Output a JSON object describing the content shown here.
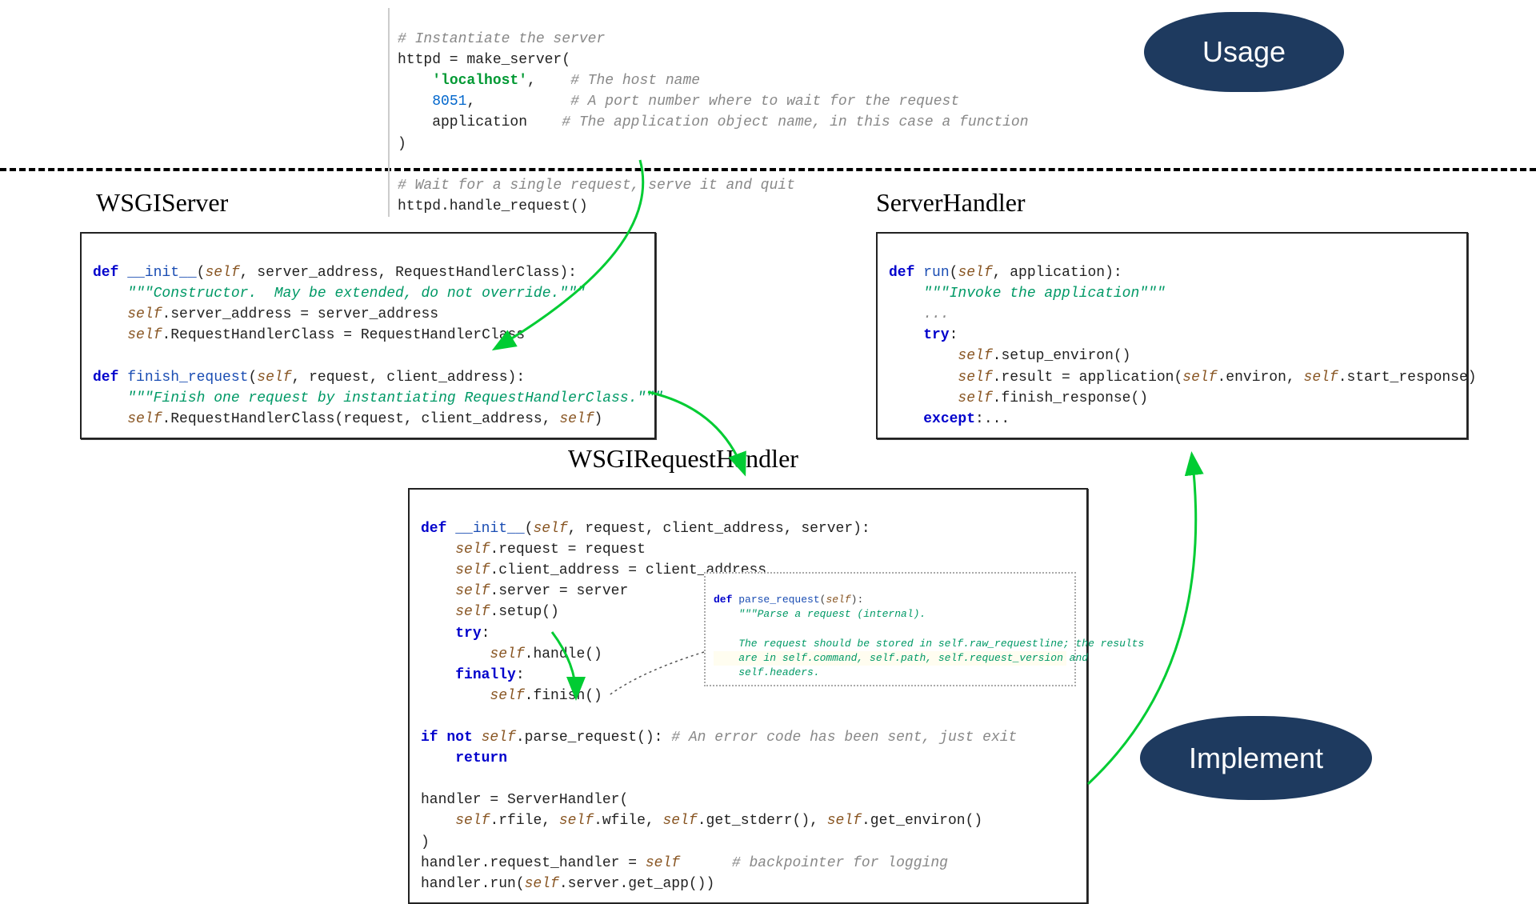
{
  "badges": {
    "usage": "Usage",
    "implement": "Implement"
  },
  "labels": {
    "wsgiserver": "WSGIServer",
    "wsgirequesthandler": "WSGIRequestHandler",
    "serverhandler": "ServerHandler"
  },
  "code": {
    "top_c1": "# Instantiate the server",
    "top_l2a": "httpd = make_server(",
    "top_l3a": "    ",
    "top_l3b": "'localhost'",
    "top_l3c": ",    ",
    "top_l3d": "# The host name",
    "top_l4a": "    ",
    "top_l4b": "8051",
    "top_l4c": ",           ",
    "top_l4d": "# A port number where to wait for the request",
    "top_l5a": "    application    ",
    "top_l5b": "# The application object name, in this case a function",
    "top_l6": ")",
    "top_blank": "",
    "top_c2": "# Wait for a single request, serve it and quit",
    "top_l8": "httpd.handle_request()",
    "ws_def1a": "def ",
    "ws_def1b": "__init__",
    "ws_def1c": "(",
    "ws_def1d": "self",
    "ws_def1e": ", server_address, RequestHandlerClass):",
    "ws_doc1": "    \"\"\"Constructor.  May be extended, do not override.\"\"\"",
    "ws_l3a": "    ",
    "ws_l3b": "self",
    "ws_l3c": ".server_address = server_address",
    "ws_l4a": "    ",
    "ws_l4b": "self",
    "ws_l4c": ".RequestHandlerClass = RequestHandlerClass",
    "ws_blank": "",
    "ws_def2a": "def ",
    "ws_def2b": "finish_request",
    "ws_def2c": "(",
    "ws_def2d": "self",
    "ws_def2e": ", request, client_address):",
    "ws_doc2": "    \"\"\"Finish one request by instantiating RequestHandlerClass.\"\"\"",
    "ws_l7a": "    ",
    "ws_l7b": "self",
    "ws_l7c": ".RequestHandlerClass(request, client_address, ",
    "ws_l7d": "self",
    "ws_l7e": ")",
    "rh_def1a": "def ",
    "rh_def1b": "__init__",
    "rh_def1c": "(",
    "rh_def1d": "self",
    "rh_def1e": ", request, client_address, server):",
    "rh_l2a": "    ",
    "rh_l2b": "self",
    "rh_l2c": ".request = request",
    "rh_l3a": "    ",
    "rh_l3b": "self",
    "rh_l3c": ".client_address = client_address",
    "rh_l4a": "    ",
    "rh_l4b": "self",
    "rh_l4c": ".server = server",
    "rh_l5a": "    ",
    "rh_l5b": "self",
    "rh_l5c": ".setup()",
    "rh_l6a": "    ",
    "rh_l6b": "try",
    "rh_l6c": ":",
    "rh_l7a": "        ",
    "rh_l7b": "self",
    "rh_l7c": ".handle()",
    "rh_l8a": "    ",
    "rh_l8b": "finally",
    "rh_l8c": ":",
    "rh_l9a": "        ",
    "rh_l9b": "self",
    "rh_l9c": ".finish()",
    "rh_l11a": "if not ",
    "rh_l11b": "self",
    "rh_l11c": ".parse_request(): ",
    "rh_l11d": "# An error code has been sent, just exit",
    "rh_l12a": "    ",
    "rh_l12b": "return",
    "rh_l14": "handler = ServerHandler(",
    "rh_l15a": "    ",
    "rh_l15b": "self",
    "rh_l15c": ".rfile, ",
    "rh_l15d": "self",
    "rh_l15e": ".wfile, ",
    "rh_l15f": "self",
    "rh_l15g": ".get_stderr(), ",
    "rh_l15h": "self",
    "rh_l15i": ".get_environ()",
    "rh_l16": ")",
    "rh_l17a": "handler.request_handler = ",
    "rh_l17b": "self",
    "rh_l17c": "      ",
    "rh_l17d": "# backpointer for logging",
    "rh_l18a": "handler.run(",
    "rh_l18b": "self",
    "rh_l18c": ".server.get_app())",
    "pr_def": "def ",
    "pr_fn": "parse_request",
    "pr_paren": "(",
    "pr_self": "self",
    "pr_close": "):",
    "pr_doc": "    \"\"\"Parse a request (internal).",
    "pr_blank": "",
    "pr_doc2": "    The request should be stored in self.raw_requestline; the results",
    "pr_doc3": "    are in self.command, self.path, self.request_version and",
    "pr_doc4": "    self.headers.",
    "sh_def1a": "def ",
    "sh_def1b": "run",
    "sh_def1c": "(",
    "sh_def1d": "self",
    "sh_def1e": ", application):",
    "sh_doc": "    \"\"\"Invoke the application\"\"\"",
    "sh_dots1": "    ...",
    "sh_try": "    try",
    "sh_tryc": ":",
    "sh_l5a": "        ",
    "sh_l5b": "self",
    "sh_l5c": ".setup_environ()",
    "sh_l6a": "        ",
    "sh_l6b": "self",
    "sh_l6c": ".result = application(",
    "sh_l6d": "self",
    "sh_l6e": ".environ, ",
    "sh_l6f": "self",
    "sh_l6g": ".start_response)",
    "sh_l7a": "        ",
    "sh_l7b": "self",
    "sh_l7c": ".finish_response()",
    "sh_l8a": "    ",
    "sh_l8b": "except",
    "sh_l8c": ":..."
  }
}
